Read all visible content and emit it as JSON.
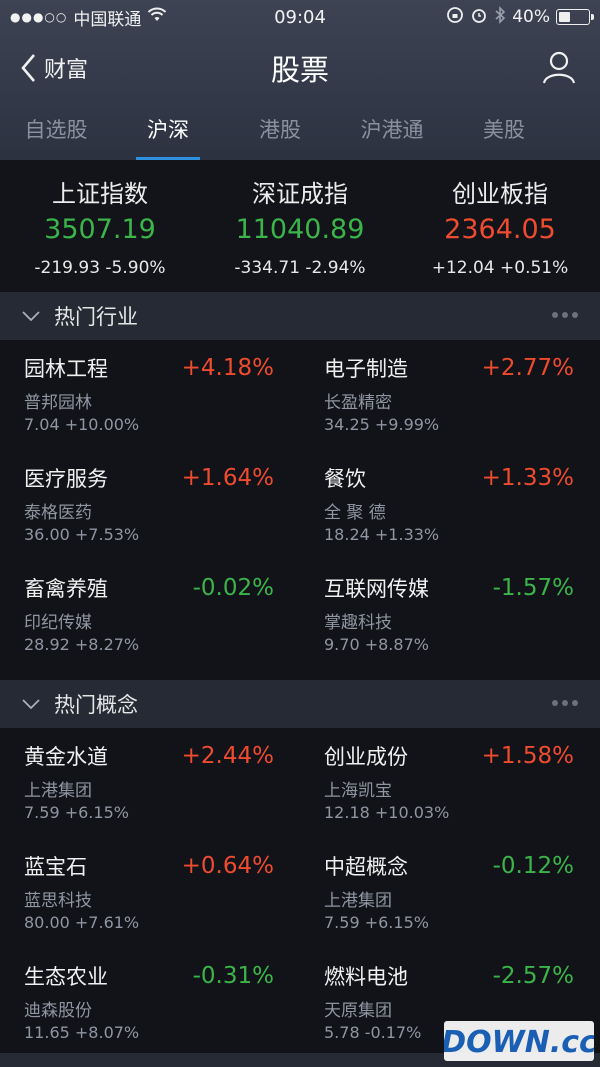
{
  "status_bar": {
    "carrier": "中国联通",
    "time": "09:04",
    "battery": "40%",
    "battery_level": 0.4
  },
  "nav": {
    "back_label": "财富",
    "title": "股票"
  },
  "tabs": [
    {
      "label": "自选股",
      "active": false
    },
    {
      "label": "沪深",
      "active": true
    },
    {
      "label": "港股",
      "active": false
    },
    {
      "label": "沪港通",
      "active": false
    },
    {
      "label": "美股",
      "active": false
    }
  ],
  "indices": [
    {
      "name": "上证指数",
      "value": "3507.19",
      "change": "-219.93 -5.90%",
      "trend": "down"
    },
    {
      "name": "深证成指",
      "value": "11040.89",
      "change": "-334.71 -2.94%",
      "trend": "down"
    },
    {
      "name": "创业板指",
      "value": "2364.05",
      "change": "+12.04 +0.51%",
      "trend": "up"
    }
  ],
  "sections": [
    {
      "title": "热门行业",
      "items": [
        {
          "name": "园林工程",
          "pct": "+4.18%",
          "trend": "up",
          "stock": "普邦园林",
          "sub": "7.04  +10.00%"
        },
        {
          "name": "电子制造",
          "pct": "+2.77%",
          "trend": "up",
          "stock": "长盈精密",
          "sub": "34.25  +9.99%"
        },
        {
          "name": "医疗服务",
          "pct": "+1.64%",
          "trend": "up",
          "stock": "泰格医药",
          "sub": "36.00  +7.53%"
        },
        {
          "name": "餐饮",
          "pct": "+1.33%",
          "trend": "up",
          "stock": "全 聚 德",
          "sub": "18.24  +1.33%"
        },
        {
          "name": "畜禽养殖",
          "pct": "-0.02%",
          "trend": "down",
          "stock": "印纪传媒",
          "sub": "28.92  +8.27%"
        },
        {
          "name": "互联网传媒",
          "pct": "-1.57%",
          "trend": "down",
          "stock": "掌趣科技",
          "sub": "9.70  +8.87%"
        }
      ]
    },
    {
      "title": "热门概念",
      "items": [
        {
          "name": "黄金水道",
          "pct": "+2.44%",
          "trend": "up",
          "stock": "上港集团",
          "sub": "7.59  +6.15%"
        },
        {
          "name": "创业成份",
          "pct": "+1.58%",
          "trend": "up",
          "stock": "上海凯宝",
          "sub": "12.18  +10.03%"
        },
        {
          "name": "蓝宝石",
          "pct": "+0.64%",
          "trend": "up",
          "stock": "蓝思科技",
          "sub": "80.00  +7.61%"
        },
        {
          "name": "中超概念",
          "pct": "-0.12%",
          "trend": "down",
          "stock": "上港集团",
          "sub": "7.59  +6.15%"
        },
        {
          "name": "生态农业",
          "pct": "-0.31%",
          "trend": "down",
          "stock": "迪森股份",
          "sub": "11.65  +8.07%"
        },
        {
          "name": "燃料电池",
          "pct": "-2.57%",
          "trend": "down",
          "stock": "天原集团",
          "sub": "5.78  -0.17%"
        }
      ]
    }
  ],
  "watermark": {
    "text": "DOWN.cc"
  },
  "colors": {
    "up": "#ef4b2f",
    "down": "#3bb54a",
    "tab_accent": "#2f8fe0",
    "background": "#111318",
    "section_header": "#252a34"
  }
}
